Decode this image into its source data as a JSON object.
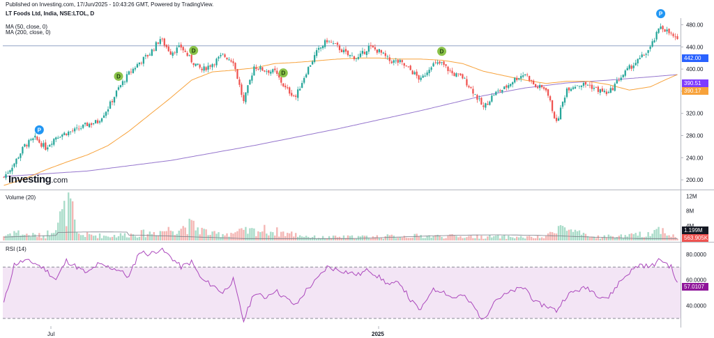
{
  "header": {
    "published": "Published on Investing.com, 17/Jun/2025 - 10:43:26 GMT, Powered by TradingView.",
    "symbol": "LT Foods Ltd, India, NSE:LTOL, D",
    "ma50": "MA (50, close, 0)",
    "ma200": "MA (200, close, 0)",
    "logo_main": "Investing",
    "logo_suffix": ".com"
  },
  "price_tags": {
    "last": "442.00",
    "ma200_value": "390.51",
    "ma50_value": "390.17",
    "last_color": "#2962ff",
    "ma200_color": "#7e3bff",
    "ma50_color": "#f7a23b"
  },
  "volume": {
    "title": "Volume (20)",
    "tag_ma": "1.199M",
    "tag_last": "563.905K",
    "tag_ma_color": "#131722",
    "tag_last_color": "#ef5350"
  },
  "rsi": {
    "title": "RSI (14)",
    "value_tag": "57.0107",
    "tag_color": "#8e1599"
  },
  "x_axis": {
    "labels": [
      "Jul",
      "2025"
    ]
  },
  "chart_data": {
    "type": "candlestick",
    "price_axis": {
      "ticks": [
        "480.00",
        "440.00",
        "400.00",
        "360.00",
        "320.00",
        "280.00",
        "240.00",
        "200.00"
      ],
      "range": [
        185,
        492
      ],
      "tick_values": [
        480,
        440,
        400,
        360,
        320,
        280,
        240,
        200
      ]
    },
    "volume_axis": {
      "ticks": [
        "12M",
        "8M",
        "4M"
      ],
      "tick_values": [
        12,
        8,
        4
      ],
      "range": [
        0,
        13
      ]
    },
    "rsi_axis": {
      "ticks": [
        "80.0000",
        "60.0000",
        "40.0000"
      ],
      "tick_values": [
        80,
        60,
        40
      ],
      "range": [
        24,
        88
      ],
      "bands": [
        70,
        30
      ]
    },
    "horizontal_line": 442,
    "colors": {
      "up": "#26a69a",
      "down": "#ef5350",
      "vol_up": "#a9dcc9",
      "vol_down": "#f4b6b4",
      "ma50": "#f7a23b",
      "ma200": "#9575cd",
      "rsi_line": "#ab47bc",
      "rsi_band": "#f3e5f5",
      "hline": "#90a4c6"
    },
    "price_keypoints": [
      [
        0,
        205
      ],
      [
        5,
        230
      ],
      [
        10,
        262
      ],
      [
        15,
        275
      ],
      [
        20,
        258
      ],
      [
        25,
        278
      ],
      [
        30,
        285
      ],
      [
        35,
        290
      ],
      [
        40,
        300
      ],
      [
        45,
        305
      ],
      [
        50,
        330
      ],
      [
        55,
        365
      ],
      [
        60,
        392
      ],
      [
        65,
        412
      ],
      [
        70,
        428
      ],
      [
        75,
        455
      ],
      [
        80,
        430
      ],
      [
        85,
        440
      ],
      [
        90,
        415
      ],
      [
        95,
        398
      ],
      [
        100,
        410
      ],
      [
        105,
        425
      ],
      [
        110,
        415
      ],
      [
        115,
        340
      ],
      [
        120,
        405
      ],
      [
        125,
        398
      ],
      [
        130,
        395
      ],
      [
        135,
        365
      ],
      [
        140,
        350
      ],
      [
        145,
        395
      ],
      [
        150,
        430
      ],
      [
        155,
        452
      ],
      [
        160,
        440
      ],
      [
        165,
        425
      ],
      [
        170,
        420
      ],
      [
        175,
        440
      ],
      [
        180,
        432
      ],
      [
        185,
        415
      ],
      [
        190,
        412
      ],
      [
        195,
        398
      ],
      [
        200,
        380
      ],
      [
        205,
        408
      ],
      [
        210,
        410
      ],
      [
        215,
        392
      ],
      [
        220,
        385
      ],
      [
        225,
        360
      ],
      [
        230,
        330
      ],
      [
        235,
        355
      ],
      [
        240,
        365
      ],
      [
        245,
        382
      ],
      [
        250,
        392
      ],
      [
        255,
        368
      ],
      [
        260,
        365
      ],
      [
        265,
        302
      ],
      [
        270,
        365
      ],
      [
        275,
        372
      ],
      [
        280,
        372
      ],
      [
        285,
        362
      ],
      [
        290,
        356
      ],
      [
        295,
        382
      ],
      [
        300,
        402
      ],
      [
        305,
        418
      ],
      [
        310,
        438
      ],
      [
        315,
        478
      ],
      [
        320,
        462
      ],
      [
        323,
        450
      ]
    ],
    "ma50_keypoints": [
      [
        0,
        190
      ],
      [
        10,
        202
      ],
      [
        20,
        218
      ],
      [
        30,
        232
      ],
      [
        40,
        245
      ],
      [
        50,
        262
      ],
      [
        60,
        288
      ],
      [
        70,
        318
      ],
      [
        80,
        348
      ],
      [
        90,
        380
      ],
      [
        100,
        395
      ],
      [
        110,
        398
      ],
      [
        120,
        402
      ],
      [
        130,
        410
      ],
      [
        140,
        412
      ],
      [
        150,
        415
      ],
      [
        160,
        418
      ],
      [
        170,
        420
      ],
      [
        180,
        420
      ],
      [
        190,
        418
      ],
      [
        200,
        418
      ],
      [
        210,
        416
      ],
      [
        220,
        410
      ],
      [
        230,
        396
      ],
      [
        240,
        388
      ],
      [
        250,
        380
      ],
      [
        260,
        374
      ],
      [
        270,
        378
      ],
      [
        280,
        378
      ],
      [
        290,
        372
      ],
      [
        300,
        362
      ],
      [
        310,
        368
      ],
      [
        318,
        382
      ],
      [
        323,
        390
      ]
    ],
    "ma200_keypoints": [
      [
        0,
        206
      ],
      [
        40,
        216
      ],
      [
        80,
        235
      ],
      [
        120,
        262
      ],
      [
        160,
        292
      ],
      [
        200,
        325
      ],
      [
        230,
        352
      ],
      [
        250,
        366
      ],
      [
        270,
        375
      ],
      [
        290,
        380
      ],
      [
        310,
        386
      ],
      [
        323,
        390
      ]
    ],
    "volume_keypoints": [
      [
        0,
        1.5
      ],
      [
        5,
        3
      ],
      [
        10,
        2
      ],
      [
        20,
        1.5
      ],
      [
        32,
        12
      ],
      [
        35,
        2
      ],
      [
        50,
        1.5
      ],
      [
        70,
        2.5
      ],
      [
        90,
        5
      ],
      [
        100,
        2
      ],
      [
        125,
        3.5
      ],
      [
        150,
        1
      ],
      [
        200,
        1.5
      ],
      [
        260,
        1
      ],
      [
        265,
        5
      ],
      [
        280,
        1.2
      ],
      [
        300,
        1.5
      ],
      [
        310,
        2.5
      ],
      [
        315,
        4
      ],
      [
        323,
        0.6
      ]
    ],
    "rsi_keypoints": [
      [
        0,
        42
      ],
      [
        5,
        72
      ],
      [
        10,
        75
      ],
      [
        15,
        73
      ],
      [
        20,
        68
      ],
      [
        25,
        60
      ],
      [
        30,
        75
      ],
      [
        35,
        70
      ],
      [
        40,
        65
      ],
      [
        45,
        72
      ],
      [
        50,
        70
      ],
      [
        55,
        68
      ],
      [
        60,
        62
      ],
      [
        65,
        82
      ],
      [
        70,
        80
      ],
      [
        75,
        84
      ],
      [
        80,
        78
      ],
      [
        85,
        70
      ],
      [
        90,
        74
      ],
      [
        95,
        60
      ],
      [
        100,
        56
      ],
      [
        105,
        50
      ],
      [
        110,
        60
      ],
      [
        115,
        28
      ],
      [
        120,
        50
      ],
      [
        125,
        46
      ],
      [
        130,
        52
      ],
      [
        135,
        46
      ],
      [
        140,
        40
      ],
      [
        145,
        52
      ],
      [
        150,
        60
      ],
      [
        155,
        70
      ],
      [
        160,
        68
      ],
      [
        165,
        66
      ],
      [
        170,
        64
      ],
      [
        175,
        68
      ],
      [
        180,
        62
      ],
      [
        185,
        56
      ],
      [
        190,
        58
      ],
      [
        195,
        44
      ],
      [
        200,
        36
      ],
      [
        205,
        52
      ],
      [
        210,
        52
      ],
      [
        215,
        46
      ],
      [
        220,
        48
      ],
      [
        225,
        40
      ],
      [
        230,
        28
      ],
      [
        235,
        44
      ],
      [
        240,
        48
      ],
      [
        245,
        52
      ],
      [
        250,
        54
      ],
      [
        255,
        42
      ],
      [
        260,
        40
      ],
      [
        265,
        36
      ],
      [
        270,
        48
      ],
      [
        275,
        52
      ],
      [
        280,
        54
      ],
      [
        285,
        48
      ],
      [
        290,
        46
      ],
      [
        295,
        58
      ],
      [
        300,
        66
      ],
      [
        305,
        72
      ],
      [
        310,
        70
      ],
      [
        315,
        76
      ],
      [
        320,
        70
      ],
      [
        323,
        57
      ]
    ],
    "events": [
      {
        "label": "P",
        "index": 17,
        "color": "#2196f3"
      },
      {
        "label": "D",
        "index": 55,
        "color": "#8bc34a"
      },
      {
        "label": "D",
        "index": 91,
        "color": "#8bc34a"
      },
      {
        "label": "D",
        "index": 134,
        "color": "#8bc34a"
      },
      {
        "label": "D",
        "index": 210,
        "color": "#8bc34a"
      },
      {
        "label": "P",
        "index": 315,
        "color": "#2196f3"
      }
    ]
  }
}
